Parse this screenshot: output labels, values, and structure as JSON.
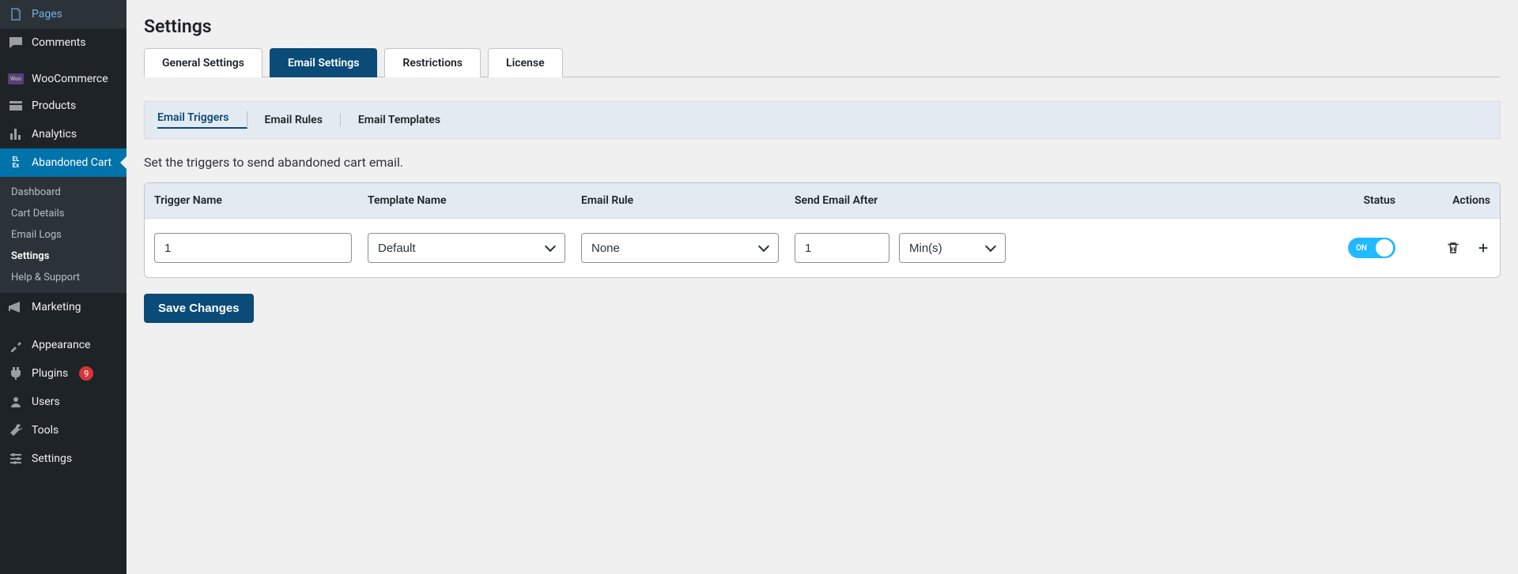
{
  "sidebar": {
    "items": [
      {
        "label": "Pages",
        "icon": "pages"
      },
      {
        "label": "Comments",
        "icon": "comments"
      },
      {
        "label": "WooCommerce",
        "icon": "woo"
      },
      {
        "label": "Products",
        "icon": "products"
      },
      {
        "label": "Analytics",
        "icon": "analytics"
      },
      {
        "label": "Abandoned Cart",
        "icon": "elex",
        "active": true
      },
      {
        "label": "Marketing",
        "icon": "marketing"
      },
      {
        "label": "Appearance",
        "icon": "appearance"
      },
      {
        "label": "Plugins",
        "icon": "plugins",
        "badge": "9"
      },
      {
        "label": "Users",
        "icon": "users"
      },
      {
        "label": "Tools",
        "icon": "tools"
      },
      {
        "label": "Settings",
        "icon": "settings"
      }
    ],
    "submenu": [
      {
        "label": "Dashboard"
      },
      {
        "label": "Cart Details"
      },
      {
        "label": "Email Logs"
      },
      {
        "label": "Settings",
        "current": true
      },
      {
        "label": "Help & Support"
      }
    ]
  },
  "page": {
    "title": "Settings"
  },
  "tabs": [
    {
      "label": "General Settings"
    },
    {
      "label": "Email Settings",
      "active": true
    },
    {
      "label": "Restrictions"
    },
    {
      "label": "License"
    }
  ],
  "subtabs": [
    {
      "label": "Email Triggers",
      "active": true
    },
    {
      "label": "Email Rules"
    },
    {
      "label": "Email Templates"
    }
  ],
  "description": "Set the triggers to send abandoned cart email.",
  "table": {
    "headers": {
      "trigger_name": "Trigger Name",
      "template_name": "Template Name",
      "email_rule": "Email Rule",
      "send_after": "Send Email After",
      "status": "Status",
      "actions": "Actions"
    },
    "row": {
      "trigger_name_value": "1",
      "template_value": "Default",
      "rule_value": "None",
      "after_value": "1",
      "after_unit": "Min(s)",
      "toggle_label": "ON"
    }
  },
  "buttons": {
    "save": "Save Changes"
  }
}
